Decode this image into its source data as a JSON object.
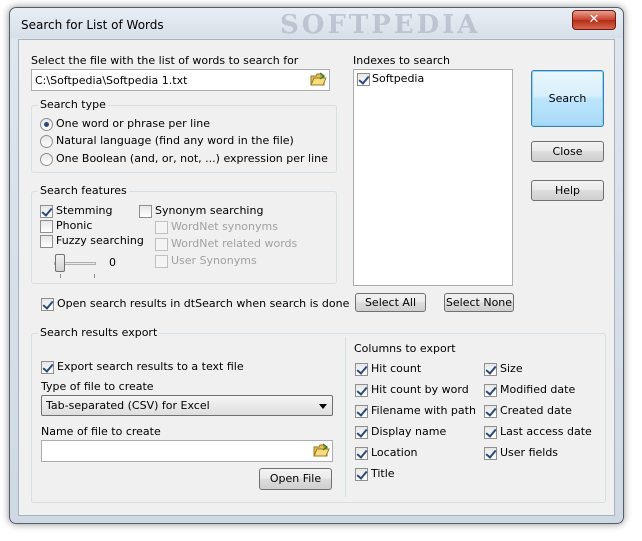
{
  "window": {
    "title": "Search for List of Words",
    "watermark": "SOFTPEDIA",
    "close_glyph": "✕"
  },
  "file": {
    "label": "Select the file with the list of words to search for",
    "value": "C:\\Softpedia\\Softpedia 1.txt",
    "browse_icon": "folder-open-icon"
  },
  "search_type": {
    "title": "Search type",
    "options": [
      {
        "label": "One word or phrase per line",
        "checked": true
      },
      {
        "label": "Natural language (find any word in the file)",
        "checked": false
      },
      {
        "label": "One Boolean (and, or, not, ...) expression per line",
        "checked": false
      }
    ]
  },
  "search_features": {
    "title": "Search features",
    "stemming": {
      "label": "Stemming",
      "checked": true
    },
    "phonic": {
      "label": "Phonic",
      "checked": false
    },
    "fuzzy": {
      "label": "Fuzzy searching",
      "checked": false
    },
    "fuzzy_value": "0",
    "synonym": {
      "label": "Synonym searching",
      "checked": false
    },
    "wordnet_synonyms": {
      "label": "WordNet synonyms",
      "checked": false,
      "enabled": false
    },
    "wordnet_related": {
      "label": "WordNet related words",
      "checked": false,
      "enabled": false
    },
    "user_synonyms": {
      "label": "User Synonyms",
      "checked": false,
      "enabled": false
    }
  },
  "open_results": {
    "label": "Open search results in dtSearch when search is done",
    "checked": true
  },
  "indexes": {
    "label": "Indexes to search",
    "items": [
      {
        "label": "Softpedia",
        "checked": true
      }
    ],
    "select_all": "Select All",
    "select_none": "Select None"
  },
  "buttons": {
    "search": "Search",
    "close": "Close",
    "help": "Help"
  },
  "export": {
    "title": "Search results export",
    "export_to_file": {
      "label": "Export search results to a text file",
      "checked": true
    },
    "type_label": "Type of file to create",
    "type_value": "Tab-separated (CSV) for Excel",
    "name_label": "Name of file to create",
    "name_value": "",
    "open_file": "Open File"
  },
  "columns": {
    "title": "Columns to export",
    "left": [
      {
        "label": "Hit count",
        "checked": true
      },
      {
        "label": "Hit count by word",
        "checked": true
      },
      {
        "label": "Filename with path",
        "checked": true
      },
      {
        "label": "Display name",
        "checked": true
      },
      {
        "label": "Location",
        "checked": true
      },
      {
        "label": "Title",
        "checked": true
      }
    ],
    "right": [
      {
        "label": "Size",
        "checked": true
      },
      {
        "label": "Modified date",
        "checked": true
      },
      {
        "label": "Created date",
        "checked": true
      },
      {
        "label": "Last access date",
        "checked": true
      },
      {
        "label": "User fields",
        "checked": true
      }
    ]
  }
}
